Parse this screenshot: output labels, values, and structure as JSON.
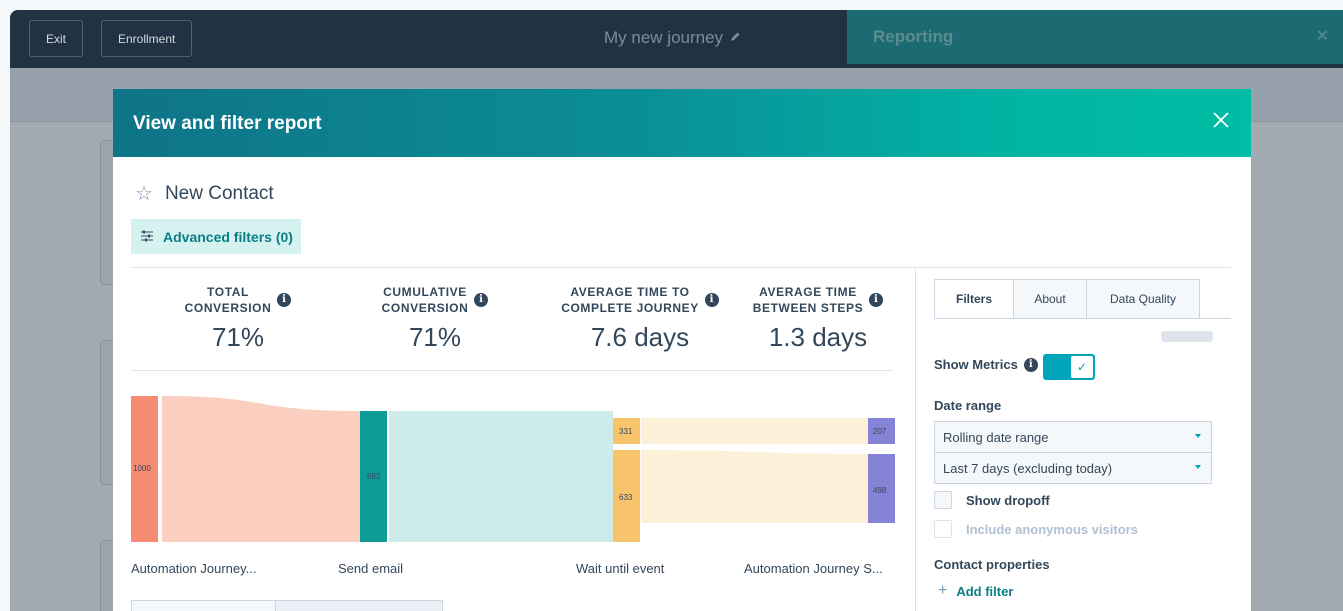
{
  "topbar": {
    "exit_label": "Exit",
    "enrollment_label": "Enrollment",
    "journey_title": "My new journey",
    "reporting_title": "Reporting",
    "close_symbol": "✕"
  },
  "modal": {
    "title": "View and filter report",
    "close_symbol": "✕",
    "report_name": "New Contact",
    "advanced_filters_label": "Advanced filters (0)",
    "metrics": [
      {
        "label_line1": "TOTAL",
        "label_line2": "CONVERSION",
        "value": "71%"
      },
      {
        "label_line1": "CUMULATIVE",
        "label_line2": "CONVERSION",
        "value": "71%"
      },
      {
        "label_line1": "AVERAGE TIME TO",
        "label_line2": "COMPLETE JOURNEY",
        "value": "7.6 days"
      },
      {
        "label_line1": "AVERAGE TIME",
        "label_line2": "BETWEEN STEPS",
        "value": "1.3 days"
      }
    ],
    "stages": [
      "Automation Journey...",
      "Send email",
      "Wait until event",
      "Automation Journey S..."
    ],
    "sankey_nodes": {
      "start": "1000",
      "send_email": "982",
      "wait_upper": "331",
      "wait_lower": "633",
      "end_upper": "207",
      "end_lower": "498"
    },
    "colors": {
      "start": "#f58c73",
      "send_email": "#0e9c99",
      "wait": "#f8c46b",
      "end": "#8583d6",
      "flow_start": "#fbcfbf",
      "flow_email": "#cdebea",
      "flow_wait": "#fdf0d9"
    }
  },
  "side_panel": {
    "tabs": [
      "Filters",
      "About",
      "Data Quality"
    ],
    "active_tab": "Filters",
    "show_metrics_label": "Show Metrics",
    "show_metrics_on": true,
    "date_range_label": "Date range",
    "date_range_type": "Rolling date range",
    "date_range_value": "Last 7 days (excluding today)",
    "show_dropoff_label": "Show dropoff",
    "include_anonymous_label": "Include anonymous visitors",
    "contact_properties_label": "Contact properties",
    "add_filter_label": "Add filter"
  }
}
